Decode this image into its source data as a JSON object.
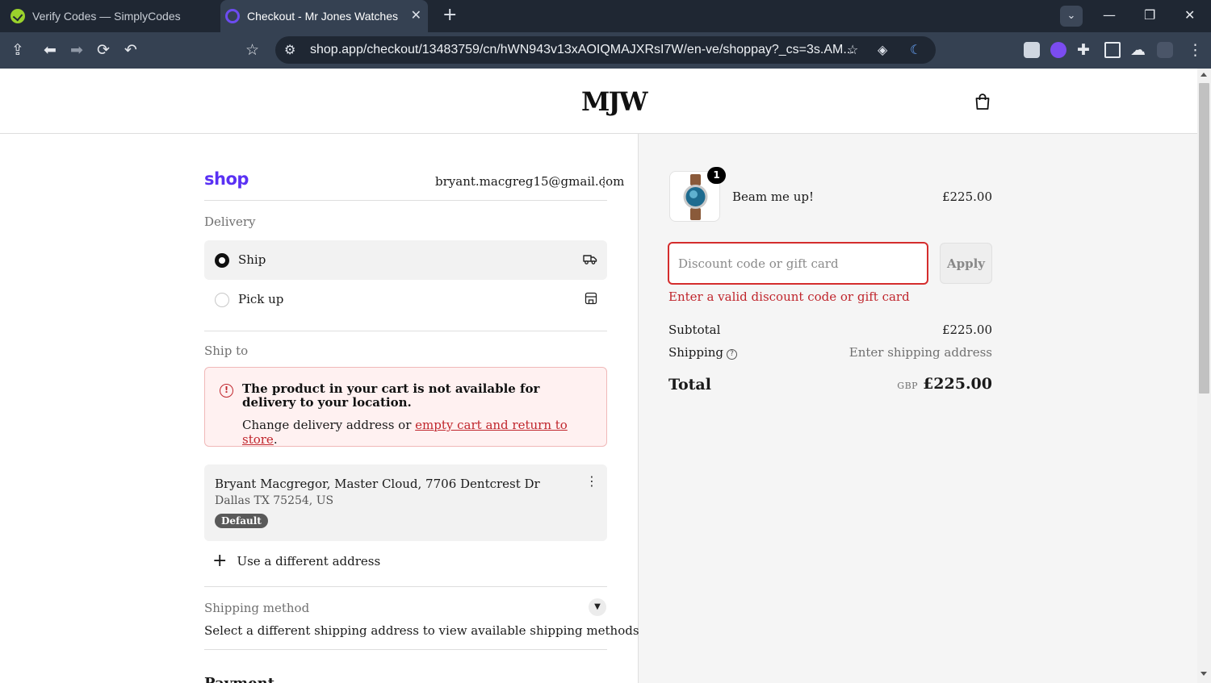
{
  "browser": {
    "tabs": [
      {
        "title": "Verify Codes — SimplyCodes",
        "active": false
      },
      {
        "title": "Checkout - Mr Jones Watches",
        "active": true
      }
    ],
    "url": "shop.app/checkout/13483759/cn/hWN943v13xAOIQMAJXRsI7W/en-ve/shoppay?_cs=3s.AM..."
  },
  "header": {
    "logo": "MJW"
  },
  "account": {
    "brand": "shop",
    "email": "bryant.macgreg15@gmail.com"
  },
  "delivery": {
    "heading": "Delivery",
    "options": [
      {
        "label": "Ship",
        "selected": true,
        "icon": "truck-icon"
      },
      {
        "label": "Pick up",
        "selected": false,
        "icon": "store-icon"
      }
    ]
  },
  "ship_to": {
    "heading": "Ship to",
    "alert": {
      "title": "The product in your cart is not available for delivery to your location.",
      "body_prefix": "Change delivery address or ",
      "link": "empty cart and return to store",
      "body_suffix": "."
    },
    "address": {
      "line1": "Bryant Macgregor, Master Cloud, 7706 Dentcrest Dr",
      "line2": "Dallas TX 75254, US",
      "badge": "Default"
    },
    "add_address": "Use a different address"
  },
  "shipping_method": {
    "heading": "Shipping method",
    "message": "Select a different shipping address to view available shipping methods"
  },
  "next_section": {
    "heading": "Payment"
  },
  "order": {
    "item": {
      "name": "Beam me up!",
      "price": "£225.00",
      "quantity": "1"
    },
    "discount": {
      "placeholder": "Discount code or gift card",
      "value": "",
      "apply_label": "Apply",
      "error": "Enter a valid discount code or gift card"
    },
    "summary": {
      "subtotal_label": "Subtotal",
      "subtotal_value": "£225.00",
      "shipping_label": "Shipping",
      "shipping_value": "Enter shipping address",
      "total_label": "Total",
      "currency": "GBP",
      "total_value": "£225.00"
    }
  },
  "colors": {
    "shop_brand": "#5a31f4",
    "error": "#c0262d",
    "chrome_dark": "#1f2733",
    "chrome_toolbar": "#354152"
  }
}
